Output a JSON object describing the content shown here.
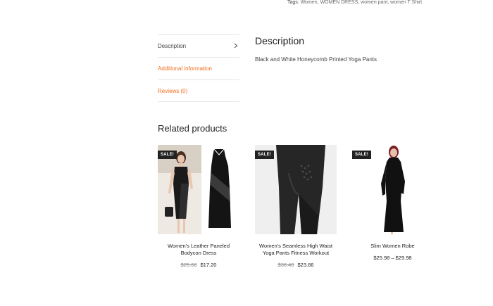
{
  "tags": {
    "label": "Tags:",
    "items": [
      "Women",
      "WOMEN DRESS",
      "women pant",
      "women T Shirt"
    ]
  },
  "tabs": [
    {
      "label": "Description",
      "has_chevron": true
    },
    {
      "label": "Additional information",
      "accent": true
    },
    {
      "label": "Reviews (0)",
      "accent": true
    }
  ],
  "description": {
    "title": "Description",
    "text": "Black and White Honeycomb Printed Yoga Pants"
  },
  "related": {
    "title": "Related products",
    "products": [
      {
        "badge": "SALE!",
        "name_line1": "Women's Leather Paneled",
        "name_line2": "Bodycon Dress",
        "old_price": "$25.66",
        "price": "$17.20"
      },
      {
        "badge": "SALE!",
        "name_line1": "Women's Seamless High Waist",
        "name_line2": "Yoga Pants Fitness Workout",
        "old_price": "$36.40",
        "price": "$23.66"
      },
      {
        "badge": "SALE!",
        "name_line1": "Slim Women Robe",
        "name_line2": "",
        "old_price": "",
        "price": "$25.98 – $29.98"
      }
    ]
  },
  "colors": {
    "accent": "#f26f21",
    "badge_bg": "#222222"
  }
}
